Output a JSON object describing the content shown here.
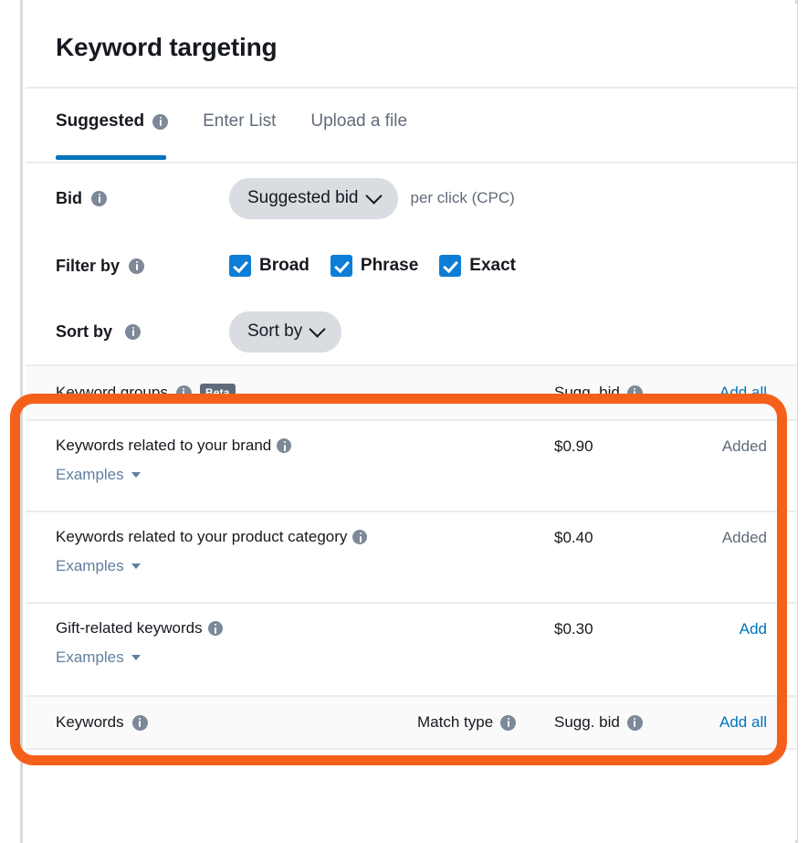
{
  "header": {
    "title": "Keyword targeting"
  },
  "tabs": [
    {
      "label": "Suggested",
      "has_info": true,
      "active": true
    },
    {
      "label": "Enter List",
      "has_info": false,
      "active": false
    },
    {
      "label": "Upload a file",
      "has_info": false,
      "active": false
    }
  ],
  "controls": {
    "bid": {
      "label": "Bid",
      "select_value": "Suggested bid",
      "suffix": "per click (CPC)"
    },
    "filter": {
      "label": "Filter by",
      "options": [
        {
          "label": "Broad",
          "checked": true
        },
        {
          "label": "Phrase",
          "checked": true
        },
        {
          "label": "Exact",
          "checked": true
        }
      ]
    },
    "sort": {
      "label": "Sort by",
      "select_value": "Sort by"
    }
  },
  "keyword_groups_table": {
    "headers": {
      "name": "Keyword groups",
      "badge": "Beta",
      "bid": "Sugg. bid",
      "action": "Add all"
    },
    "rows": [
      {
        "name": "Keywords related to your brand",
        "examples_label": "Examples",
        "bid": "$0.90",
        "action": "Added",
        "action_enabled": false
      },
      {
        "name": "Keywords related to your product category",
        "examples_label": "Examples",
        "bid": "$0.40",
        "action": "Added",
        "action_enabled": false
      },
      {
        "name": "Gift-related keywords",
        "examples_label": "Examples",
        "bid": "$0.30",
        "action": "Add",
        "action_enabled": true
      }
    ]
  },
  "keywords_table": {
    "headers": {
      "name": "Keywords",
      "match_type": "Match type",
      "bid": "Sugg. bid",
      "action": "Add all"
    }
  },
  "annotation": {
    "shape": "rounded-rectangle-highlight",
    "color": "#f4601a"
  },
  "colors": {
    "accent_link": "#0073bb",
    "checkbox": "#0d7dd6",
    "tab_underline": "#0073bb",
    "info_icon": "#7d8998",
    "badge_bg": "#5f6b7a",
    "pill_bg": "#d9dde2",
    "annotation": "#f4601a"
  }
}
